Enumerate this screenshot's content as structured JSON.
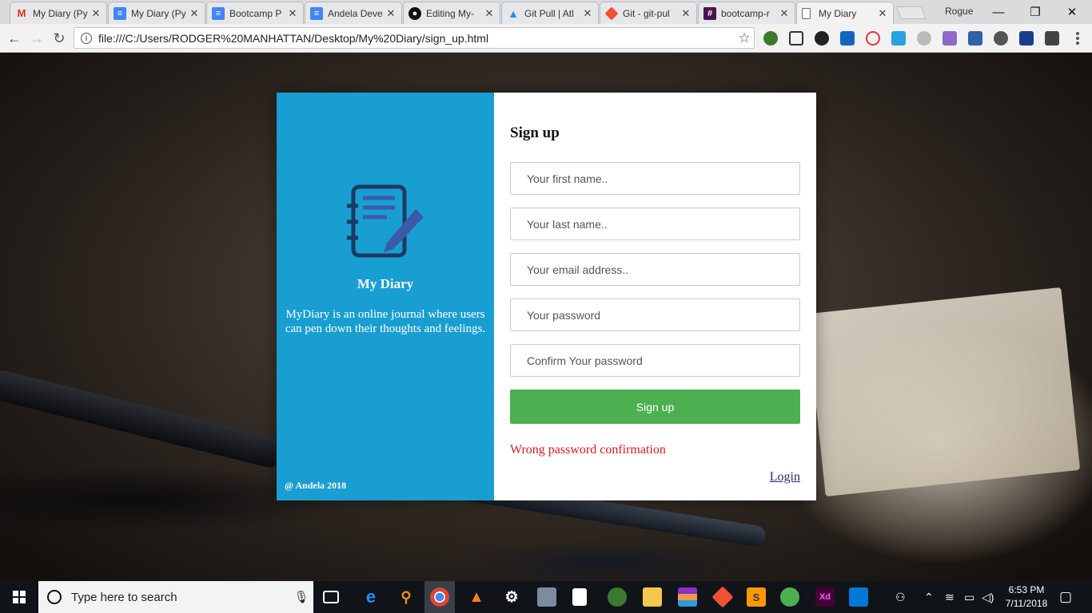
{
  "browser": {
    "tabs": [
      {
        "title": "My Diary (Py",
        "icon": "gmail-icon",
        "color": "#ffffff"
      },
      {
        "title": "My Diary (Py",
        "icon": "google-docs-icon",
        "color": "#4285f4"
      },
      {
        "title": "Bootcamp P",
        "icon": "google-docs-icon",
        "color": "#4285f4"
      },
      {
        "title": "Andela Deve",
        "icon": "google-docs-icon",
        "color": "#4285f4"
      },
      {
        "title": "Editing My-",
        "icon": "github-icon",
        "color": "#111111"
      },
      {
        "title": "Git Pull | Atl",
        "icon": "atlassian-icon",
        "color": "#2684ff"
      },
      {
        "title": "Git - git-pul",
        "icon": "git-icon",
        "color": "#f05033"
      },
      {
        "title": "bootcamp-r",
        "icon": "slack-icon",
        "color": "#4a154b"
      },
      {
        "title": "My Diary",
        "icon": "page-icon",
        "color": "#ffffff",
        "active": true
      }
    ],
    "profile_name": "Rogue",
    "url": "file:///C:/Users/RODGER%20MANHATTAN/Desktop/My%20Diary/sign_up.html"
  },
  "brand": {
    "title": "My Diary",
    "description": "MyDiary is an online journal where users can pen down their thoughts and feelings.",
    "copyright": "@ Andela 2018",
    "color": "#199ed2",
    "logo_icon": "notebook-pen-icon"
  },
  "signup": {
    "heading": "Sign up",
    "first_name_placeholder": "Your first name..",
    "last_name_placeholder": "Your last name..",
    "email_placeholder": "Your email address..",
    "password_placeholder": "Your password",
    "confirm_placeholder": "Confirm Your password",
    "submit_label": "Sign up",
    "submit_color": "#4caf50",
    "error_message": "Wrong password confirmation",
    "error_color": "#d81b1b",
    "login_link": "Login"
  },
  "taskbar": {
    "search_placeholder": "Type here to search",
    "time": "6:53 PM",
    "date": "7/11/2018"
  }
}
